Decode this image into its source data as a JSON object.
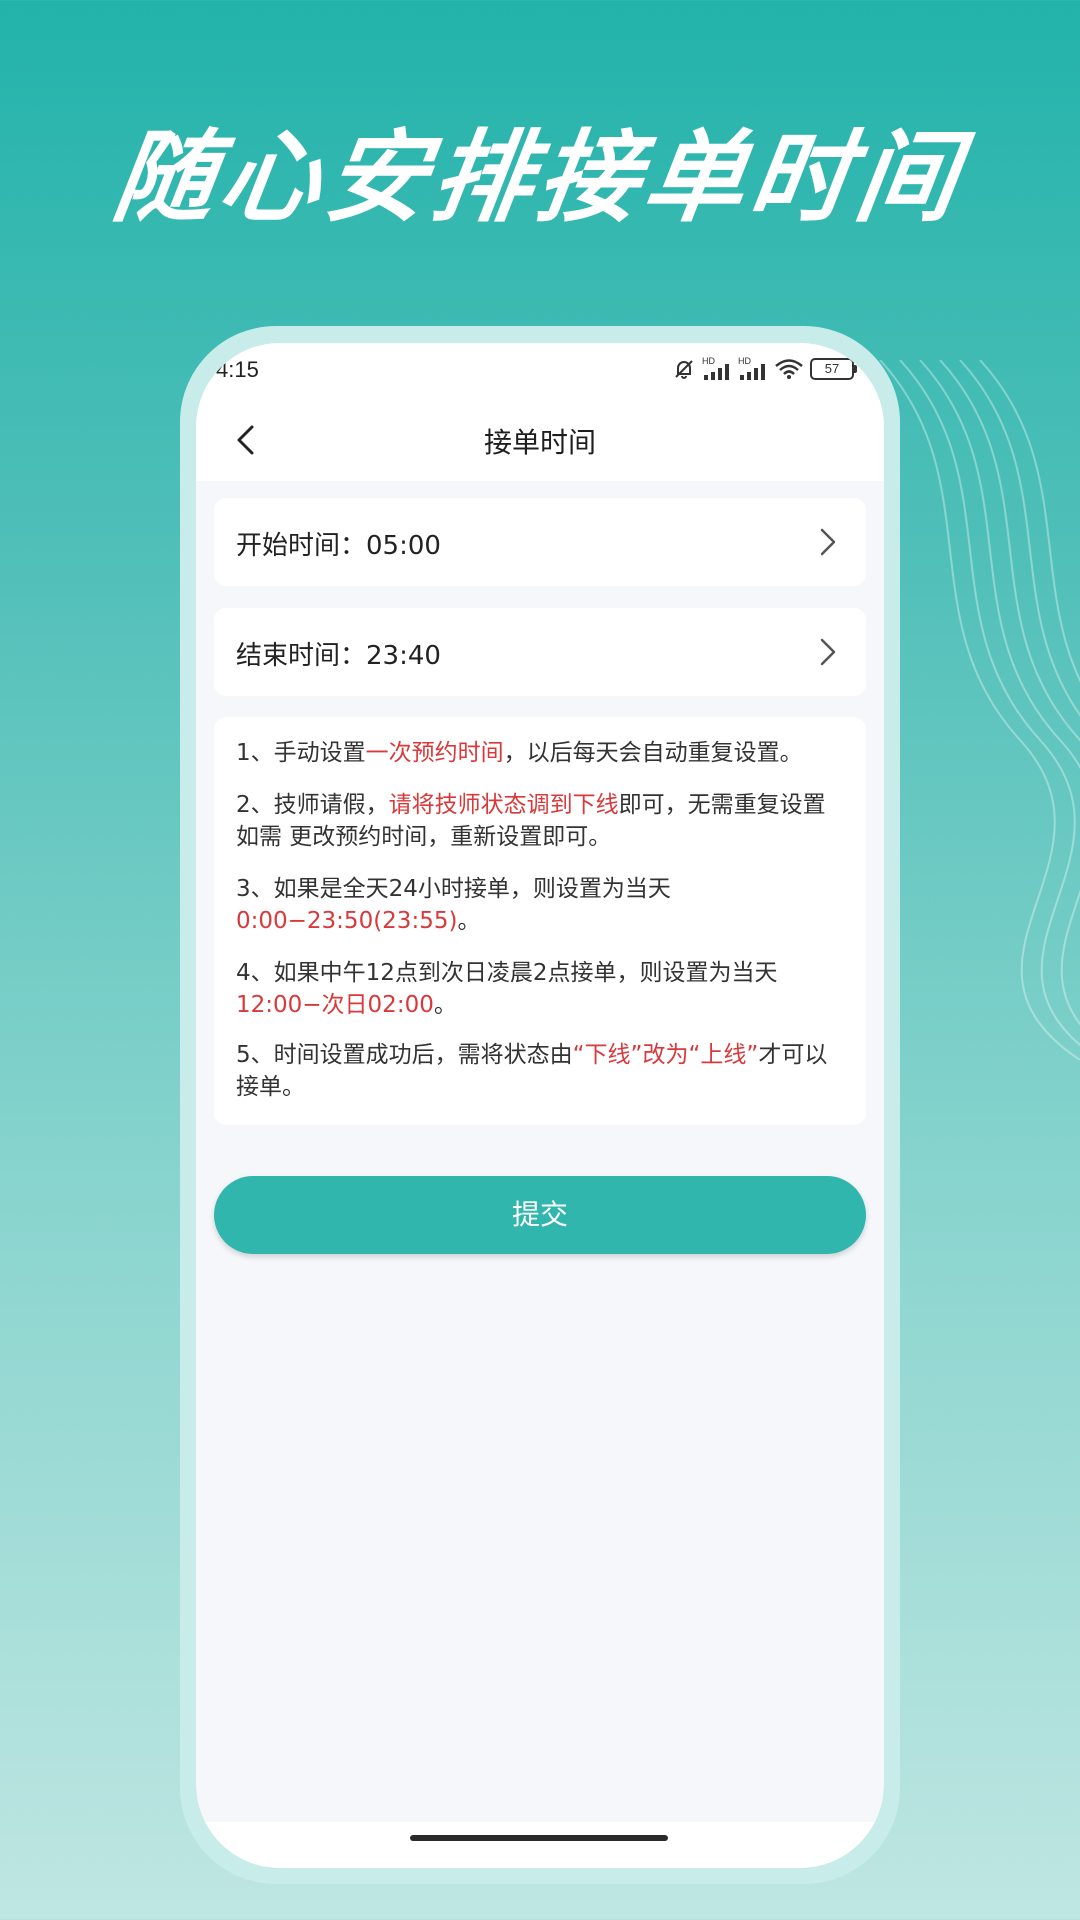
{
  "promo": {
    "title": "随心安排接单时间"
  },
  "status_bar": {
    "time": "4:15",
    "battery": "57",
    "hd1": "HD",
    "hd2": "HD"
  },
  "nav": {
    "title": "接单时间"
  },
  "start_time": {
    "label": "开始时间：",
    "value": "05:00"
  },
  "end_time": {
    "label": "结束时间：",
    "value": "23:40"
  },
  "notes": [
    {
      "parts": [
        "1、手动设置",
        "一次预约时间",
        "，以后每天会自动重复设置。"
      ]
    },
    {
      "parts": [
        "2、技师请假，",
        "请将技师状态调到下线",
        "即可，无需重复设置如需 更改预约时间，重新设置即可。"
      ]
    },
    {
      "parts": [
        "3、如果是全天24小时接单，则设置为当天",
        "0:00−23:50(23:55)",
        "。"
      ]
    },
    {
      "parts": [
        "4、如果中午12点到次日凌晨2点接单，则设置为当天",
        "12:00−次日02:00",
        "。"
      ]
    },
    {
      "parts": [
        "5、时间设置成功后，需将状态由",
        "“下线”改为“上线”",
        "才可以接单。"
      ]
    }
  ],
  "submit": {
    "label": "提交"
  },
  "colors": {
    "accent": "#30b6ad",
    "highlight": "#d9393b"
  }
}
